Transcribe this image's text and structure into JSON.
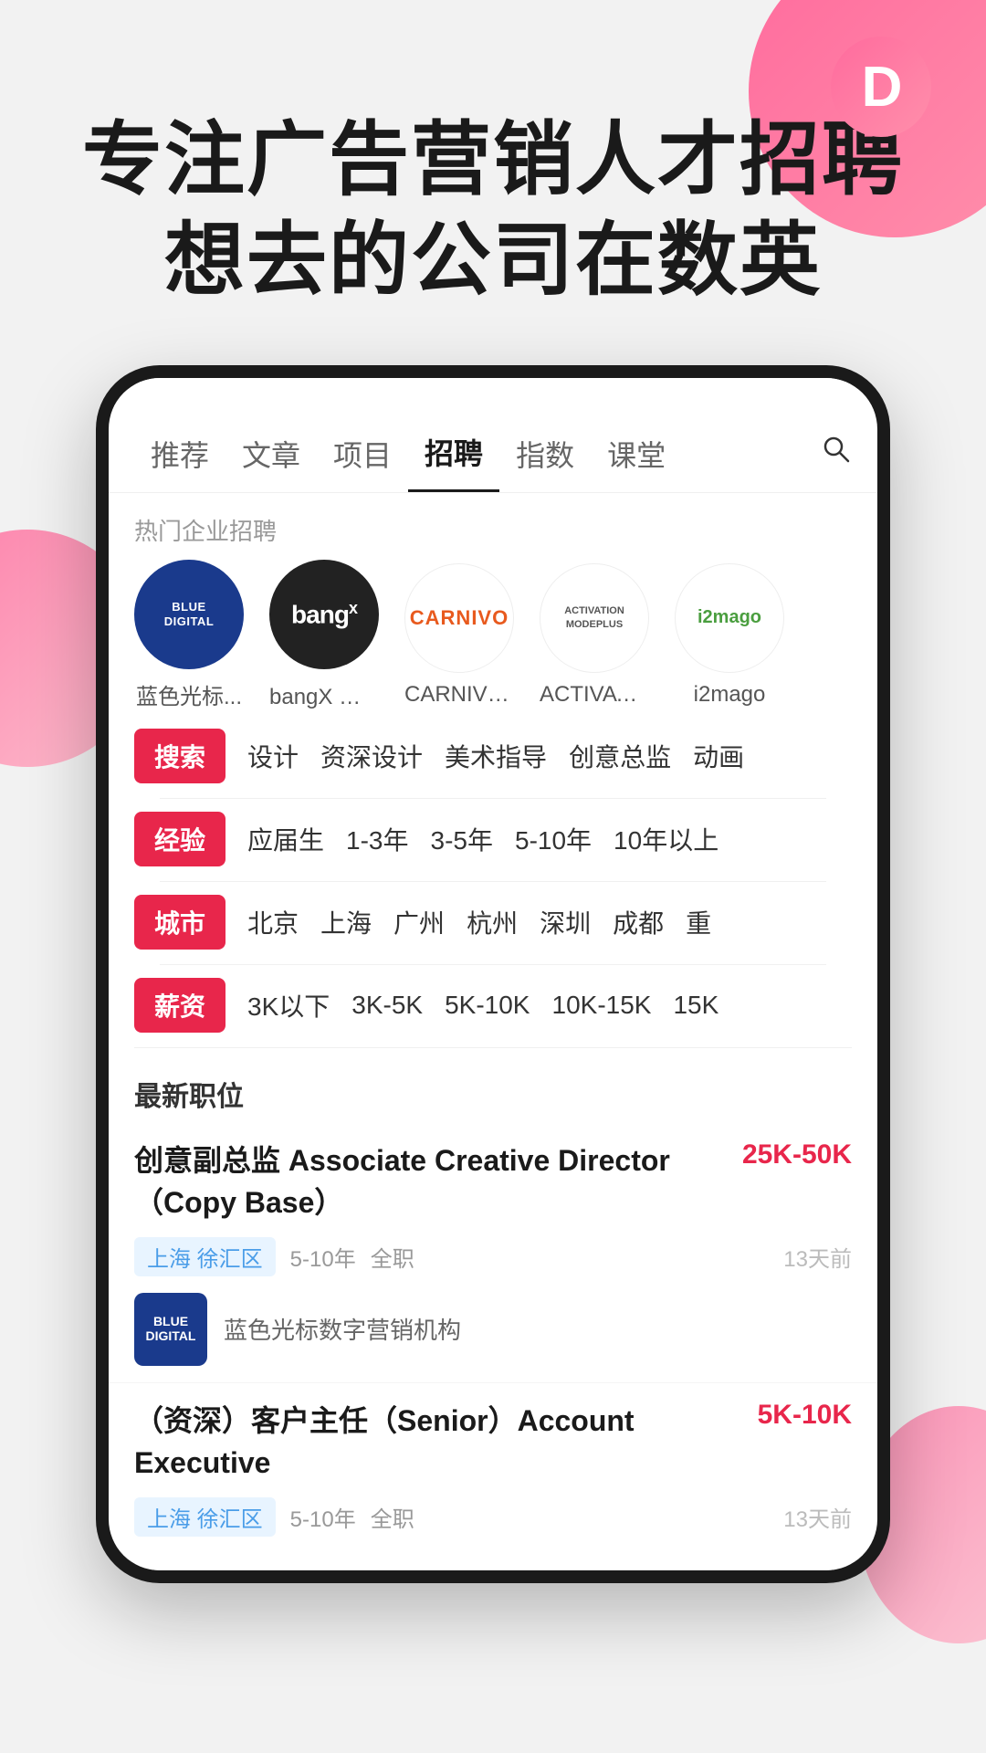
{
  "app": {
    "logo_letter": "D"
  },
  "hero": {
    "line1": "专注广告营销人才招聘",
    "line2": "想去的公司在数英"
  },
  "nav": {
    "tabs": [
      {
        "label": "推荐",
        "active": false
      },
      {
        "label": "文章",
        "active": false
      },
      {
        "label": "项目",
        "active": false
      },
      {
        "label": "招聘",
        "active": true
      },
      {
        "label": "指数",
        "active": false
      },
      {
        "label": "课堂",
        "active": false
      }
    ],
    "search_icon": "search"
  },
  "hot_companies": {
    "section_label": "热门企业招聘",
    "items": [
      {
        "name": "蓝色光标...",
        "logo_type": "blue_digital"
      },
      {
        "name": "bangX 上海",
        "logo_type": "bangx"
      },
      {
        "name": "CARNIVO...",
        "logo_type": "carnivo"
      },
      {
        "name": "ACTIVATIO...",
        "logo_type": "activation"
      },
      {
        "name": "i2mago",
        "logo_type": "i2mago"
      }
    ]
  },
  "filters": [
    {
      "tag": "搜索",
      "options": [
        "设计",
        "资深设计",
        "美术指导",
        "创意总监",
        "动画"
      ]
    },
    {
      "tag": "经验",
      "options": [
        "应届生",
        "1-3年",
        "3-5年",
        "5-10年",
        "10年以上"
      ]
    },
    {
      "tag": "城市",
      "options": [
        "北京",
        "上海",
        "广州",
        "杭州",
        "深圳",
        "成都",
        "重"
      ]
    },
    {
      "tag": "薪资",
      "options": [
        "3K以下",
        "3K-5K",
        "5K-10K",
        "10K-15K",
        "15K"
      ]
    }
  ],
  "latest_jobs": {
    "section_title": "最新职位",
    "jobs": [
      {
        "title": "创意副总监 Associate Creative Director（Copy Base）",
        "salary": "25K-50K",
        "location": "上海 徐汇区",
        "experience": "5-10年",
        "type": "全职",
        "time": "13天前",
        "company": "蓝色光标数字营销机构",
        "company_logo": "blue_digital"
      },
      {
        "title": "（资深）客户主任（Senior）Account Executive",
        "salary": "5K-10K",
        "location": "上海 徐汇区",
        "experience": "5-10年",
        "type": "全职",
        "time": "13天前",
        "company": "",
        "company_logo": ""
      }
    ]
  }
}
